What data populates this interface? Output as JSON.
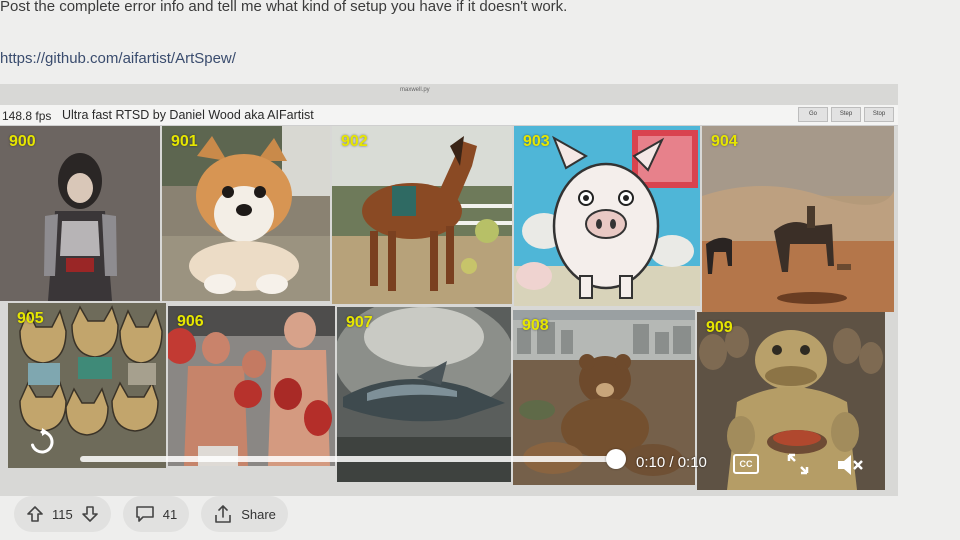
{
  "post": {
    "text": "Post the complete error info and tell me what kind of setup you have if it doesn't work.",
    "link": "https://github.com/aifartist/ArtSpew/"
  },
  "window": {
    "title": "maxwell.py",
    "fps": "148.8 fps",
    "subtitle": "Ultra fast RTSD by Daniel Wood aka AIFartist",
    "buttons": [
      "Go",
      "Step",
      "Stop"
    ]
  },
  "grid": {
    "cells": [
      {
        "num": "900",
        "subject": "armored-heroine"
      },
      {
        "num": "901",
        "subject": "puppy"
      },
      {
        "num": "902",
        "subject": "horse"
      },
      {
        "num": "903",
        "subject": "cartoon-pig"
      },
      {
        "num": "904",
        "subject": "desert-camels"
      },
      {
        "num": "905",
        "subject": "cats"
      },
      {
        "num": "906",
        "subject": "boxers"
      },
      {
        "num": "907",
        "subject": "spaceship"
      },
      {
        "num": "908",
        "subject": "bear-city"
      },
      {
        "num": "909",
        "subject": "frog-creature"
      }
    ]
  },
  "player": {
    "progress": 1.0,
    "time": "0:10 / 0:10",
    "cc_label": "CC"
  },
  "actions": {
    "votes": "115",
    "comments": "41",
    "share": "Share"
  },
  "colors": {
    "cell_number": "#e6e600",
    "page_bg": "#eeeeed"
  }
}
